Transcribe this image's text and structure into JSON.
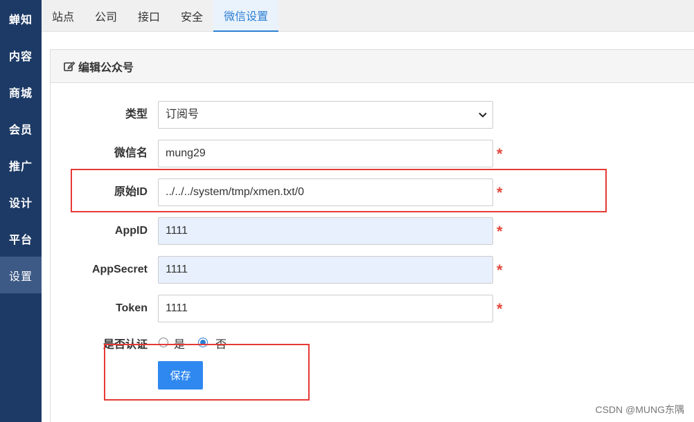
{
  "sidebar": {
    "items": [
      {
        "label": "蝉知",
        "active": false
      },
      {
        "label": "内容",
        "active": false
      },
      {
        "label": "商城",
        "active": false
      },
      {
        "label": "会员",
        "active": false
      },
      {
        "label": "推广",
        "active": false
      },
      {
        "label": "设计",
        "active": false
      },
      {
        "label": "平台",
        "active": false
      },
      {
        "label": "设置",
        "active": true
      }
    ]
  },
  "tabs": [
    {
      "label": "站点",
      "active": false
    },
    {
      "label": "公司",
      "active": false
    },
    {
      "label": "接口",
      "active": false
    },
    {
      "label": "安全",
      "active": false
    },
    {
      "label": "微信设置",
      "active": true
    }
  ],
  "panel": {
    "title": "编辑公众号",
    "title_icon": "edit-icon"
  },
  "form": {
    "type": {
      "label": "类型",
      "value": "订阅号",
      "options": [
        "订阅号"
      ]
    },
    "name": {
      "label": "微信名",
      "value": "mung29",
      "required": "*"
    },
    "original_id": {
      "label": "原始ID",
      "value": "../../../system/tmp/xmen.txt/0",
      "required": "*"
    },
    "appid": {
      "label": "AppID",
      "value": "1111",
      "required": "*"
    },
    "appsecret": {
      "label": "AppSecret",
      "value": "1111",
      "required": "*"
    },
    "token": {
      "label": "Token",
      "value": "1111",
      "required": "*"
    },
    "certified": {
      "label": "是否认证",
      "option_yes": "是",
      "option_no": "否",
      "selected": "否"
    },
    "save_label": "保存"
  },
  "watermark": "CSDN @MUNG东隅",
  "colors": {
    "sidebar": "#1d3a66",
    "accent": "#2f88f0",
    "required": "#e3473c",
    "highlight_box": "#e53935"
  }
}
